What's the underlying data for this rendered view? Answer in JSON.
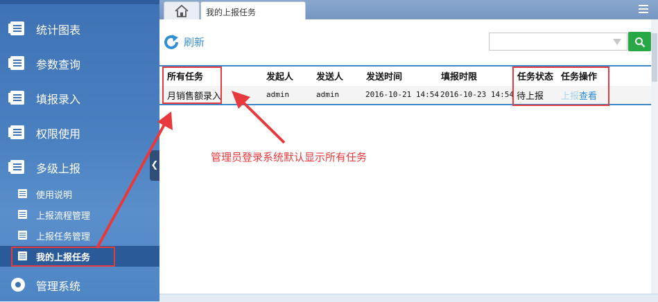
{
  "sidebar": {
    "items": [
      {
        "label": "统计图表"
      },
      {
        "label": "参数查询"
      },
      {
        "label": "填报录入"
      },
      {
        "label": "权限使用"
      },
      {
        "label": "多级上报"
      }
    ],
    "subitems": [
      {
        "label": "使用说明"
      },
      {
        "label": "上报流程管理"
      },
      {
        "label": "上报任务管理"
      },
      {
        "label": "我的上报任务"
      }
    ],
    "bottom_item": {
      "label": "管理系统"
    }
  },
  "tabs": {
    "home_icon": "home-icon",
    "current": "我的上报任务"
  },
  "toolbar": {
    "refresh_label": "刷新",
    "search_value": "",
    "search_placeholder": ""
  },
  "table": {
    "headers": [
      "所有任务",
      "发起人",
      "发送人",
      "发送时间",
      "填报时限",
      "任务状态",
      "任务操作"
    ],
    "rows": [
      {
        "task": "月销售额录入",
        "initiator": "admin",
        "sender": "admin",
        "send_time": "2016-10-21 14:54",
        "deadline": "2016-10-23 14:54",
        "status": "待上报",
        "action_report": "上报",
        "action_view": "查看"
      }
    ]
  },
  "annotation": "管理员登录系统默认显示所有任务",
  "colors": {
    "sidebar": "#4a80c0",
    "accent_blue": "#3a86c8",
    "search_green": "#27a844",
    "annotation_red": "#e8393c",
    "disabled_link": "#a8d0ec",
    "link_blue": "#2a8ad4"
  }
}
